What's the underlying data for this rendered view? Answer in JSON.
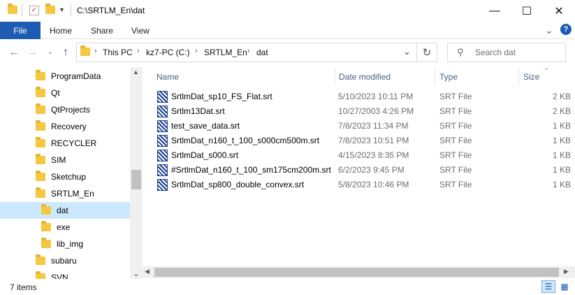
{
  "window": {
    "title": "C:\\SRTLM_En\\dat",
    "minimize": "—",
    "maximize": "☐",
    "close": "✕"
  },
  "ribbon": {
    "tabs": [
      "File",
      "Home",
      "Share",
      "View"
    ],
    "expand_icon": "⌄",
    "help_icon": "?"
  },
  "address": {
    "crumbs": [
      "This PC",
      "kz7-PC (C:)",
      "SRTLM_En",
      "dat"
    ],
    "search_placeholder": "Search dat"
  },
  "nav": {
    "items": [
      {
        "label": "ProgramData",
        "indent": 0,
        "selected": false
      },
      {
        "label": "Qt",
        "indent": 0,
        "selected": false
      },
      {
        "label": "QtProjects",
        "indent": 0,
        "selected": false
      },
      {
        "label": "Recovery",
        "indent": 0,
        "selected": false
      },
      {
        "label": "RECYCLER",
        "indent": 0,
        "selected": false
      },
      {
        "label": "SIM",
        "indent": 0,
        "selected": false
      },
      {
        "label": "Sketchup",
        "indent": 0,
        "selected": false
      },
      {
        "label": "SRTLM_En",
        "indent": 0,
        "selected": false
      },
      {
        "label": "dat",
        "indent": 1,
        "selected": true
      },
      {
        "label": "exe",
        "indent": 1,
        "selected": false
      },
      {
        "label": "lib_img",
        "indent": 1,
        "selected": false
      },
      {
        "label": "subaru",
        "indent": 0,
        "selected": false
      },
      {
        "label": "SVN",
        "indent": 0,
        "selected": false
      }
    ]
  },
  "columns": {
    "name": "Name",
    "date": "Date modified",
    "type": "Type",
    "size": "Size"
  },
  "files": [
    {
      "name": "SrtlmDat_sp10_FS_Flat.srt",
      "date": "5/10/2023 10:11 PM",
      "type": "SRT File",
      "size": "2 KB"
    },
    {
      "name": "Srtlm13Dat.srt",
      "date": "10/27/2003 4:26 PM",
      "type": "SRT File",
      "size": "2 KB"
    },
    {
      "name": "test_save_data.srt",
      "date": "7/8/2023 11:34 PM",
      "type": "SRT File",
      "size": "1 KB"
    },
    {
      "name": "SrtlmDat_n160_t_100_s000cm500m.srt",
      "date": "7/8/2023 10:51 PM",
      "type": "SRT File",
      "size": "1 KB"
    },
    {
      "name": "SrtlmDat_s000.srt",
      "date": "4/15/2023 8:35 PM",
      "type": "SRT File",
      "size": "1 KB"
    },
    {
      "name": "#SrtlmDat_n160_t_100_sm175cm200m.srt",
      "date": "6/2/2023 9:45 PM",
      "type": "SRT File",
      "size": "1 KB"
    },
    {
      "name": "SrtlmDat_sp800_double_convex.srt",
      "date": "5/8/2023 10:46 PM",
      "type": "SRT File",
      "size": "1 KB"
    }
  ],
  "status": {
    "count": "7 items"
  }
}
